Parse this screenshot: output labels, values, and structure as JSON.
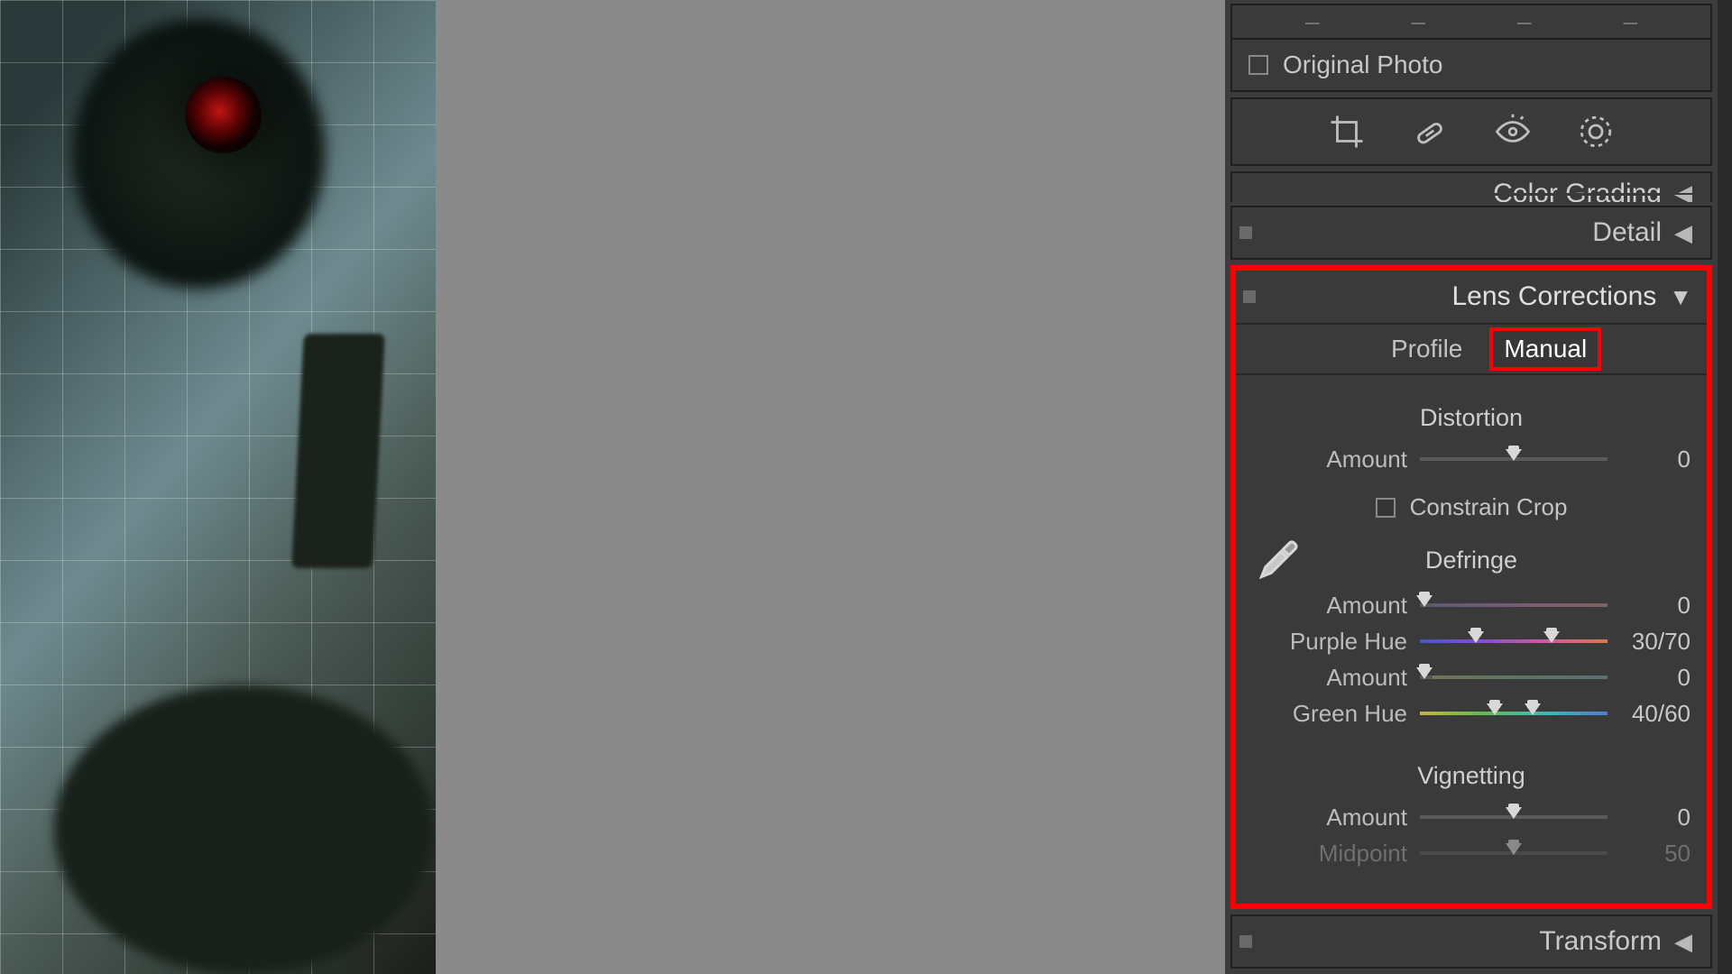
{
  "topbar": {
    "dashes": [
      "–",
      "–",
      "–",
      "–"
    ]
  },
  "original_photo": {
    "label": "Original Photo",
    "checked": false
  },
  "tools": [
    "crop-icon",
    "heal-icon",
    "redeye-icon",
    "radial-icon"
  ],
  "color_grading": {
    "title": "Color Grading"
  },
  "detail": {
    "title": "Detail"
  },
  "lens": {
    "title": "Lens Corrections",
    "tabs": {
      "profile": "Profile",
      "manual": "Manual",
      "active": "manual"
    },
    "distortion": {
      "title": "Distortion",
      "amount_label": "Amount",
      "amount_value": "0",
      "constrain_label": "Constrain Crop",
      "constrain_checked": false
    },
    "defringe": {
      "title": "Defringe",
      "purple_amount_label": "Amount",
      "purple_amount_value": "0",
      "purple_hue_label": "Purple Hue",
      "purple_hue_value": "30/70",
      "green_amount_label": "Amount",
      "green_amount_value": "0",
      "green_hue_label": "Green Hue",
      "green_hue_value": "40/60"
    },
    "vignetting": {
      "title": "Vignetting",
      "amount_label": "Amount",
      "amount_value": "0",
      "midpoint_label": "Midpoint",
      "midpoint_value": "50"
    }
  },
  "transform": {
    "title": "Transform"
  }
}
